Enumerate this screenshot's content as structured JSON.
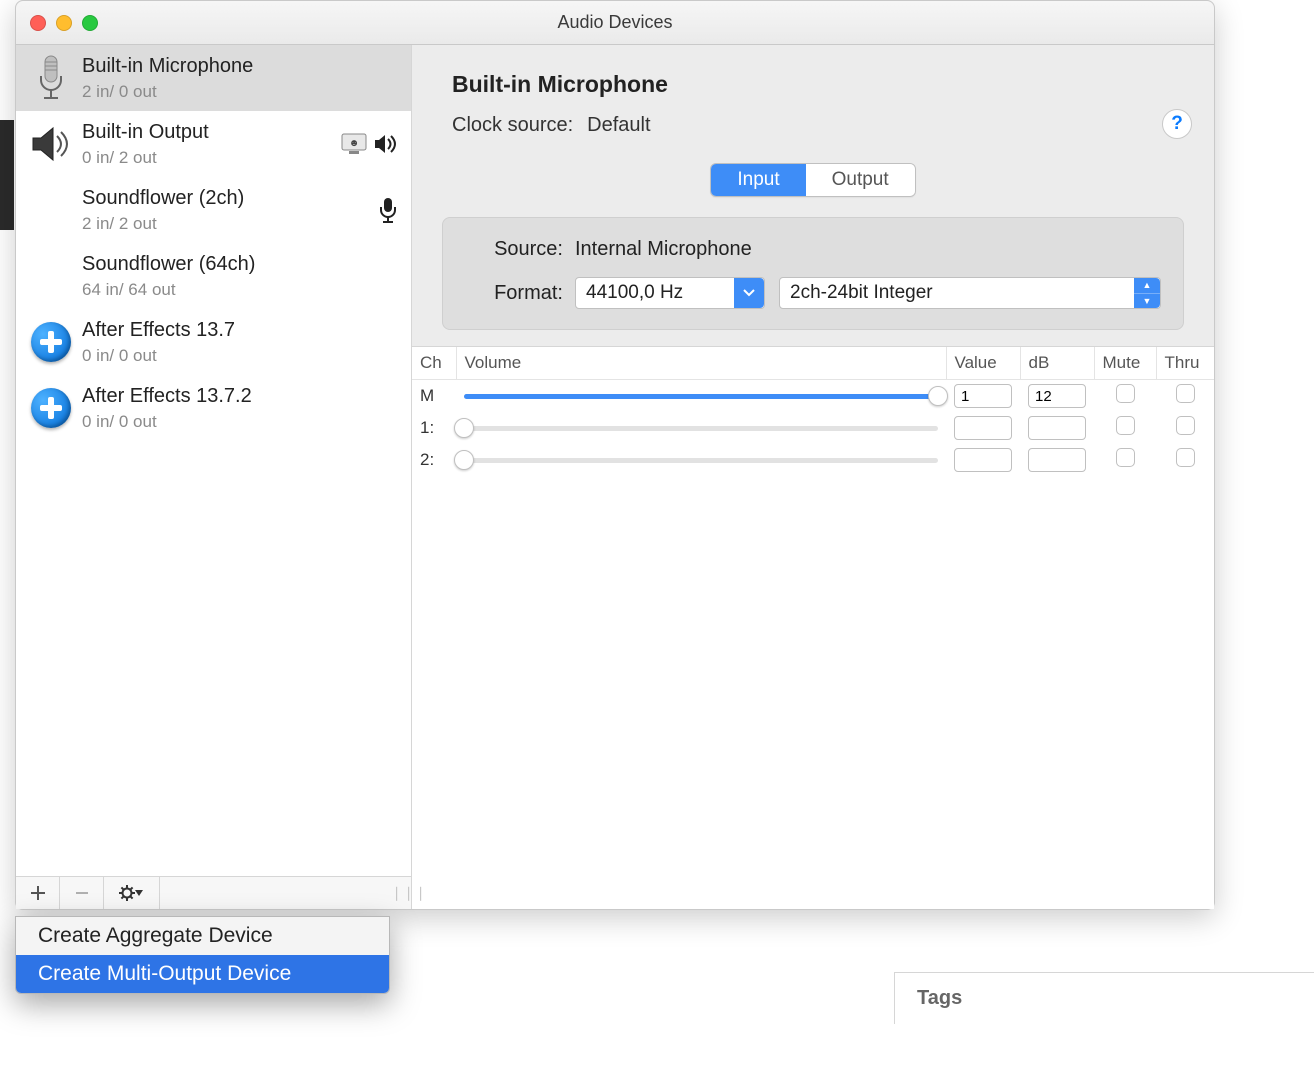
{
  "window": {
    "title": "Audio Devices"
  },
  "sidebar": {
    "devices": [
      {
        "name": "Built-in Microphone",
        "io": "2 in/ 0 out",
        "icon": "microphone",
        "selected": true,
        "badges": []
      },
      {
        "name": "Built-in Output",
        "io": "0 in/ 2 out",
        "icon": "speaker",
        "selected": false,
        "badges": [
          "system",
          "sound"
        ]
      },
      {
        "name": "Soundflower (2ch)",
        "io": "2 in/ 2 out",
        "icon": "blank",
        "selected": false,
        "badges": [
          "mic"
        ]
      },
      {
        "name": "Soundflower (64ch)",
        "io": "64 in/ 64 out",
        "icon": "blank",
        "selected": false,
        "badges": []
      },
      {
        "name": "After Effects 13.7",
        "io": "0 in/ 0 out",
        "icon": "plus",
        "selected": false,
        "badges": []
      },
      {
        "name": "After Effects 13.7.2",
        "io": "0 in/ 0 out",
        "icon": "plus",
        "selected": false,
        "badges": []
      }
    ]
  },
  "main": {
    "title": "Built-in Microphone",
    "clock_label": "Clock source:",
    "clock_value": "Default",
    "tabs": {
      "input": "Input",
      "output": "Output",
      "active": "input"
    },
    "source_label": "Source:",
    "source_value": "Internal Microphone",
    "format_label": "Format:",
    "format_freq": "44100,0 Hz",
    "format_bits": "2ch-24bit Integer",
    "columns": {
      "ch": "Ch",
      "volume": "Volume",
      "value": "Value",
      "db": "dB",
      "mute": "Mute",
      "thru": "Thru"
    },
    "channels": [
      {
        "ch": "M",
        "pos": 100,
        "value": "1",
        "db": "12",
        "mute": false,
        "thru": false
      },
      {
        "ch": "1:",
        "pos": 0,
        "value": "",
        "db": "",
        "mute": false,
        "thru": false
      },
      {
        "ch": "2:",
        "pos": 0,
        "value": "",
        "db": "",
        "mute": false,
        "thru": false
      }
    ]
  },
  "popup": {
    "items": [
      {
        "label": "Create Aggregate Device",
        "highlighted": false
      },
      {
        "label": "Create Multi-Output Device",
        "highlighted": true
      }
    ]
  },
  "footer": {
    "tags_label": "Tags"
  }
}
